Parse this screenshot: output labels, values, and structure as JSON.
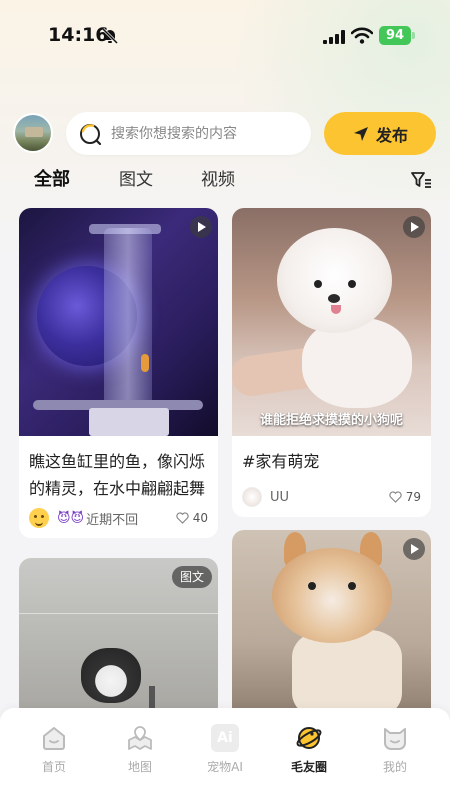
{
  "status_bar": {
    "time": "14:16",
    "battery": "94"
  },
  "search": {
    "placeholder": "搜索你想搜索的内容"
  },
  "publish": {
    "label": "发布"
  },
  "tabs": [
    {
      "label": "全部",
      "active": true
    },
    {
      "label": "图文",
      "active": false
    },
    {
      "label": "视频",
      "active": false
    }
  ],
  "cards": [
    {
      "media_type": "video",
      "title": "瞧这鱼缸里的鱼，像闪烁的精灵，在水中翩翩起舞",
      "author": "近期不回",
      "author_prefix": "😈😈",
      "likes": "40"
    },
    {
      "media_type": "video",
      "caption": "谁能拒绝求摸摸的小狗呢",
      "title": "#家有萌宠",
      "author": "UU",
      "likes": "79"
    },
    {
      "media_type": "image",
      "badge": "图文"
    },
    {
      "media_type": "video"
    }
  ],
  "bottom_nav": [
    {
      "label": "首页",
      "icon": "home-icon",
      "active": false
    },
    {
      "label": "地图",
      "icon": "map-icon",
      "active": false
    },
    {
      "label": "宠物AI",
      "icon": "ai-icon",
      "active": false
    },
    {
      "label": "毛友圈",
      "icon": "planet-icon",
      "active": true
    },
    {
      "label": "我的",
      "icon": "cat-face-icon",
      "active": false
    }
  ],
  "ai_icon_text": "Ai",
  "colors": {
    "accent": "#fdc432",
    "battery": "#43c759",
    "tab_highlight": "#fde9a5"
  }
}
